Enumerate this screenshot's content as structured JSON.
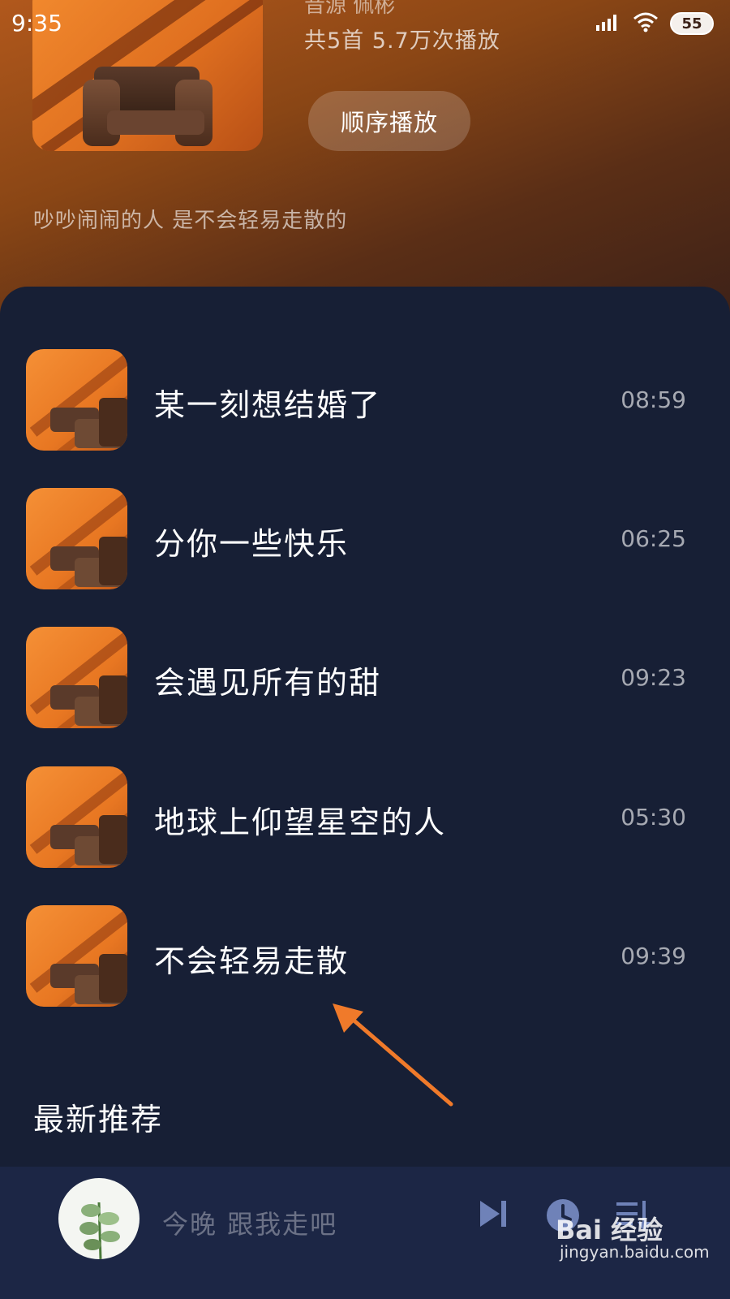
{
  "status_bar": {
    "time": "9:35",
    "battery": "55"
  },
  "album": {
    "partial_text": "音源  佩彬",
    "meta": "共5首   5.7万次播放",
    "play_button": "顺序播放",
    "description": "吵吵闹闹的人 是不会轻易走散的"
  },
  "songs": [
    {
      "title": "某一刻想结婚了",
      "duration": "08:59"
    },
    {
      "title": "分你一些快乐",
      "duration": "06:25"
    },
    {
      "title": "会遇见所有的甜",
      "duration": "09:23"
    },
    {
      "title": "地球上仰望星空的人",
      "duration": "05:30"
    },
    {
      "title": "不会轻易走散",
      "duration": "09:39"
    }
  ],
  "section": {
    "title": "最新推荐"
  },
  "player": {
    "now_playing": "今晚 跟我走吧"
  },
  "watermark": {
    "brand": "Bai 经验",
    "url": "jingyan.baidu.com"
  },
  "colors": {
    "accent_arrow": "#f07a2a",
    "panel_bg": "#171f35",
    "player_bg": "#1c2645"
  },
  "icons": [
    "signal-icon",
    "wifi-icon",
    "battery-icon",
    "next-track-icon",
    "timer-icon",
    "playlist-icon",
    "plant-icon"
  ]
}
